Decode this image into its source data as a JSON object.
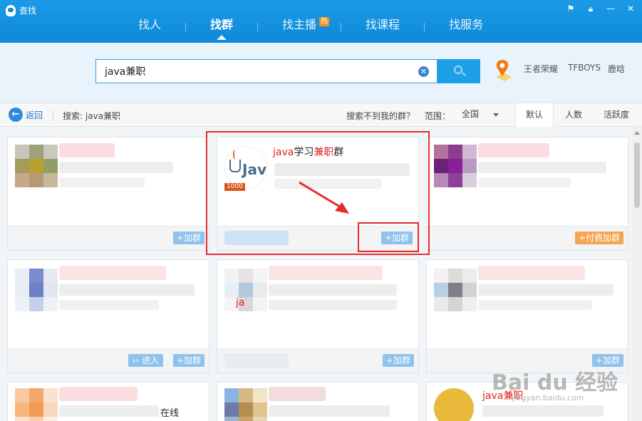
{
  "window": {
    "title": "查找"
  },
  "nav": {
    "items": [
      {
        "label": "找人",
        "active": false
      },
      {
        "label": "找群",
        "active": true
      },
      {
        "label": "找主播",
        "active": false,
        "badge": "热"
      },
      {
        "label": "找课程",
        "active": false
      },
      {
        "label": "找服务",
        "active": false
      }
    ]
  },
  "search": {
    "value": "java兼职",
    "hot_words": [
      "王者荣耀",
      "TFBOYS",
      "鹿晗"
    ]
  },
  "filter": {
    "back_label": "返回",
    "query_label": "搜索: java兼职",
    "not_found": "搜索不到我的群？",
    "scope_label": "范围：",
    "scope_value": "全国",
    "sort_tabs": [
      {
        "label": "默认",
        "active": true
      },
      {
        "label": "人数",
        "active": false
      },
      {
        "label": "活跃度",
        "active": false
      }
    ]
  },
  "cards": {
    "c1": {
      "join": "+加群"
    },
    "c2": {
      "title_kw1": "java",
      "title_mid": "学习",
      "title_kw2": "兼职",
      "title_end": "群",
      "badge": "1000",
      "join": "+加群"
    },
    "c3": {
      "join": "+付费加群"
    },
    "c4": {
      "enter": "›› 进入",
      "join": "+加群"
    },
    "c5": {
      "join": "+加群",
      "title_kw": "ja"
    },
    "c6": {
      "join": "+加群"
    },
    "c7": {
      "text_fragment": "在线"
    },
    "c9": {
      "title_kw": "java兼职"
    }
  },
  "watermark": {
    "main": "Bai du 经验",
    "sub": "jingyan.baidu.com"
  },
  "colors": {
    "brand_blue": "#0d8ad8",
    "keyword_red": "#e02020",
    "highlight_red": "#e52c2c",
    "pay_orange": "#f5a551"
  }
}
